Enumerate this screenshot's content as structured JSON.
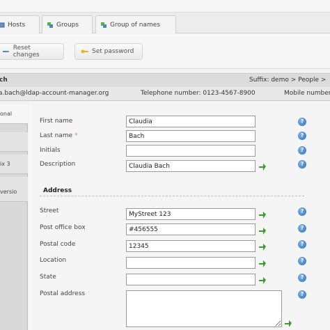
{
  "tabs": [
    {
      "label": "Hosts"
    },
    {
      "label": "Groups"
    },
    {
      "label": "Group of names"
    }
  ],
  "toolbar": {
    "reset_label": "Reset changes",
    "password_label": "Set password"
  },
  "header": {
    "title": "ch",
    "breadcrumb": "Suffix: demo > People >",
    "email": "a.bach@ldap-account-manager.org",
    "telephone": "Telephone number: 0123-4567-8900",
    "mobile": "Mobile number"
  },
  "sidebar": {
    "items": [
      {
        "label": "onal"
      },
      {
        "label": ""
      },
      {
        "label": "ix 3"
      },
      {
        "label": ""
      },
      {
        "label": "versio"
      }
    ]
  },
  "form": {
    "first_name": {
      "label": "First name",
      "value": "Claudia"
    },
    "last_name": {
      "label": "Last name",
      "required_mark": "*",
      "value": "Bach"
    },
    "initials": {
      "label": "Initials",
      "value": ""
    },
    "description": {
      "label": "Description",
      "value": "Claudia Bach"
    },
    "address_section": "Address",
    "street": {
      "label": "Street",
      "value": "MyStreet 123"
    },
    "post_office_box": {
      "label": "Post office box",
      "value": "#456555"
    },
    "postal_code": {
      "label": "Postal code",
      "value": "12345"
    },
    "location": {
      "label": "Location",
      "value": ""
    },
    "state": {
      "label": "State",
      "value": ""
    },
    "postal_address": {
      "label": "Postal address",
      "value": ""
    }
  },
  "icons": {
    "help": "help-icon",
    "add": "add-icon",
    "tab": "tab-icon",
    "password": "key-icon"
  },
  "colors": {
    "help_blue": "#2f6fc2",
    "add_green": "#3a9d2a"
  },
  "help_glyph": "?"
}
